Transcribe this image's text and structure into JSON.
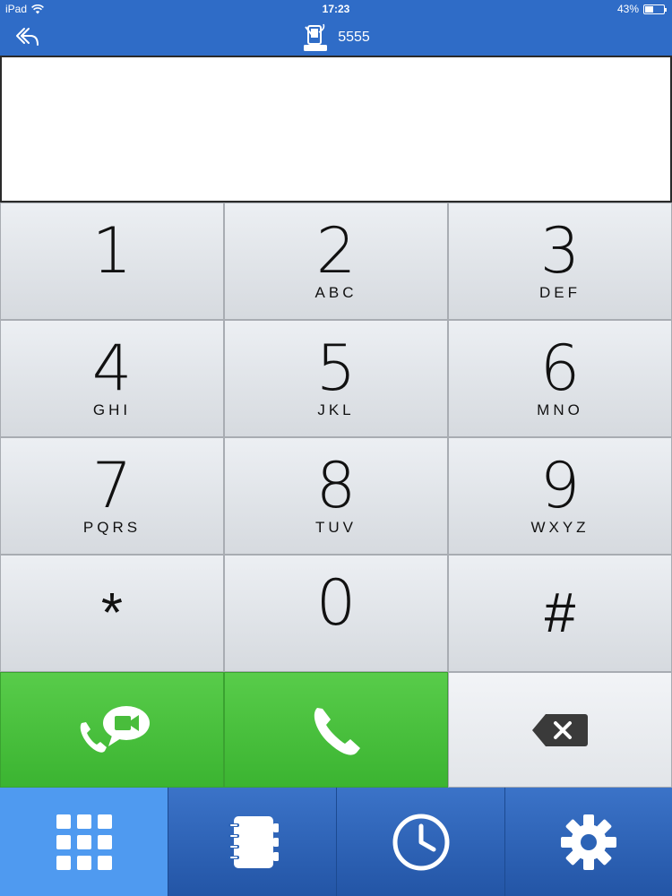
{
  "status_bar": {
    "device": "iPad",
    "time": "17:23",
    "battery": "43%",
    "battery_level": 0.43
  },
  "nav": {
    "title": "5555",
    "back_icon": "back-arrow-icon",
    "device_icon": "sip-phone-icon"
  },
  "display": {
    "number": ""
  },
  "keypad": {
    "keys": [
      {
        "digit": "1",
        "letters": ""
      },
      {
        "digit": "2",
        "letters": "ABC"
      },
      {
        "digit": "3",
        "letters": "DEF"
      },
      {
        "digit": "4",
        "letters": "GHI"
      },
      {
        "digit": "5",
        "letters": "JKL"
      },
      {
        "digit": "6",
        "letters": "MNO"
      },
      {
        "digit": "7",
        "letters": "PQRS"
      },
      {
        "digit": "8",
        "letters": "TUV"
      },
      {
        "digit": "9",
        "letters": "WXYZ"
      },
      {
        "digit": "*",
        "letters": ""
      },
      {
        "digit": "0",
        "letters": ""
      },
      {
        "digit": "#",
        "letters": ""
      }
    ],
    "video_call_icon": "video-call-icon",
    "call_icon": "phone-icon",
    "delete_icon": "backspace-icon"
  },
  "colors": {
    "header": "#2f6cc7",
    "call_green": "#4cc33f",
    "tab_active": "#4f9af0",
    "tab_inactive": "#2c63b6"
  },
  "tabs": [
    {
      "icon": "keypad-icon",
      "active": true
    },
    {
      "icon": "contacts-icon",
      "active": false
    },
    {
      "icon": "recents-clock-icon",
      "active": false
    },
    {
      "icon": "settings-gear-icon",
      "active": false
    }
  ]
}
